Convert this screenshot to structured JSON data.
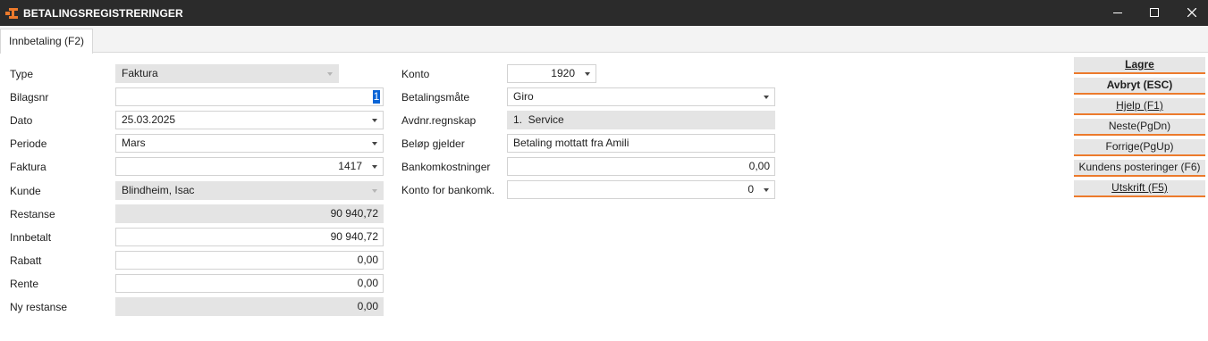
{
  "window": {
    "title": "BETALINGSREGISTRERINGER",
    "accent_color": "#ec7a2c",
    "titlebar_color": "#2b2b2b"
  },
  "tabs": [
    {
      "label": "Innbetaling (F2)",
      "active": true
    }
  ],
  "left_form": {
    "type": {
      "label": "Type",
      "value": "Faktura"
    },
    "bilagsnr": {
      "label": "Bilagsnr",
      "value": "1"
    },
    "dato": {
      "label": "Dato",
      "value": "25.03.2025"
    },
    "periode": {
      "label": "Periode",
      "value": "Mars"
    },
    "faktura": {
      "label": "Faktura",
      "value": "1417"
    },
    "kunde": {
      "label": "Kunde",
      "value": "Blindheim, Isac"
    },
    "restanse": {
      "label": "Restanse",
      "value": "90 940,72"
    },
    "innbetalt": {
      "label": "Innbetalt",
      "value": "90 940,72"
    },
    "rabatt": {
      "label": "Rabatt",
      "value": "0,00"
    },
    "rente": {
      "label": "Rente",
      "value": "0,00"
    },
    "ny_restanse": {
      "label": "Ny restanse",
      "value": "0,00"
    }
  },
  "right_form": {
    "konto": {
      "label": "Konto",
      "value": "1920"
    },
    "betalingsmate": {
      "label": "Betalingsmåte",
      "value": "Giro"
    },
    "avdnr": {
      "label": "Avdnr.regnskap",
      "value": "1.  Service"
    },
    "belop_gjelder": {
      "label": "Beløp gjelder",
      "value": "Betaling mottatt fra Amili"
    },
    "bankomkostninger": {
      "label": "Bankomkostninger",
      "value": "0,00"
    },
    "konto_bankomk": {
      "label": "Konto for bankomk.",
      "value": "0"
    }
  },
  "actions": {
    "lagre": "Lagre",
    "avbryt": "Avbryt (ESC)",
    "hjelp": "Hjelp (F1)",
    "neste": "Neste(PgDn)",
    "forrige": "Forrige(PgUp)",
    "kundens_posteringer": "Kundens posteringer (F6)",
    "utskrift": "Utskrift (F5)"
  }
}
